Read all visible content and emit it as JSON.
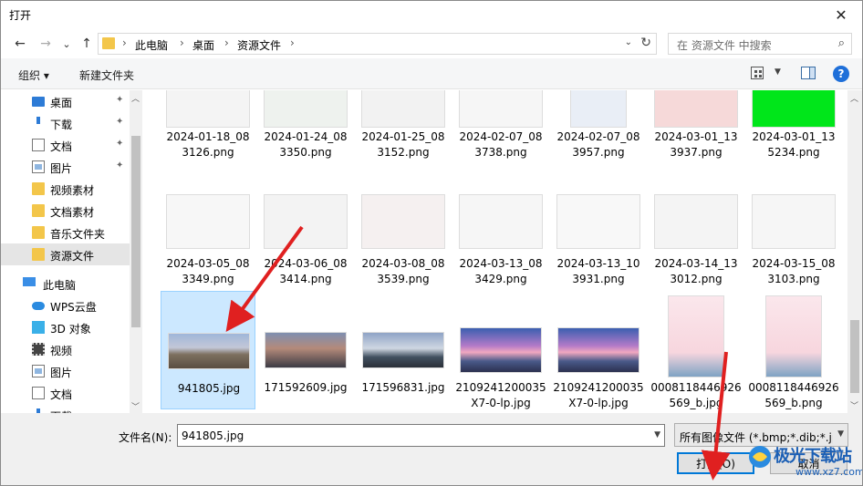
{
  "window": {
    "title": "打开",
    "close_label": "✕"
  },
  "nav": {
    "back": "←",
    "forward": "→",
    "dropdown": "⌄",
    "up": "↑"
  },
  "breadcrumb": [
    "此电脑",
    "桌面",
    "资源文件"
  ],
  "address": {
    "separator": "›",
    "dropdown": "⌄",
    "refresh": "↻"
  },
  "search": {
    "placeholder": "在 资源文件 中搜索",
    "icon": "⌕"
  },
  "toolbar": {
    "organize": "组织 ▾",
    "new_folder": "新建文件夹",
    "view_dropdown": "▼",
    "help": "?"
  },
  "sidebar": {
    "items": [
      {
        "label": "桌面",
        "pinned": true,
        "icon": "desktop-icon"
      },
      {
        "label": "下载",
        "pinned": true,
        "icon": "download-icon"
      },
      {
        "label": "文档",
        "pinned": true,
        "icon": "document-icon"
      },
      {
        "label": "图片",
        "pinned": true,
        "icon": "picture-icon"
      },
      {
        "label": "视频素材",
        "pinned": false,
        "icon": "folder-icon"
      },
      {
        "label": "文档素材",
        "pinned": false,
        "icon": "folder-icon"
      },
      {
        "label": "音乐文件夹",
        "pinned": false,
        "icon": "folder-icon"
      },
      {
        "label": "资源文件",
        "pinned": false,
        "icon": "folder-icon",
        "selected": true
      },
      {
        "label": "此电脑",
        "pinned": false,
        "icon": "pc-icon"
      },
      {
        "label": "WPS云盘",
        "pinned": false,
        "icon": "cloud-icon"
      },
      {
        "label": "3D 对象",
        "pinned": false,
        "icon": "cube-icon"
      },
      {
        "label": "视频",
        "pinned": false,
        "icon": "video-icon"
      },
      {
        "label": "图片",
        "pinned": false,
        "icon": "picture-icon"
      },
      {
        "label": "文档",
        "pinned": false,
        "icon": "document-icon"
      },
      {
        "label": "下载",
        "pinned": false,
        "icon": "download-icon"
      }
    ],
    "pin_glyph": "✦"
  },
  "files": {
    "row1": [
      {
        "l1": "2024-01-18_08",
        "l2": "3126.png"
      },
      {
        "l1": "2024-01-24_08",
        "l2": "3350.png"
      },
      {
        "l1": "2024-01-25_08",
        "l2": "3152.png"
      },
      {
        "l1": "2024-02-07_08",
        "l2": "3738.png"
      },
      {
        "l1": "2024-02-07_08",
        "l2": "3957.png"
      },
      {
        "l1": "2024-03-01_13",
        "l2": "3937.png"
      },
      {
        "l1": "2024-03-01_13",
        "l2": "5234.png"
      }
    ],
    "row2": [
      {
        "l1": "2024-03-05_08",
        "l2": "3349.png"
      },
      {
        "l1": "2024-03-06_08",
        "l2": "3414.png"
      },
      {
        "l1": "2024-03-08_08",
        "l2": "3539.png"
      },
      {
        "l1": "2024-03-13_08",
        "l2": "3429.png"
      },
      {
        "l1": "2024-03-13_10",
        "l2": "3931.png"
      },
      {
        "l1": "2024-03-14_13",
        "l2": "3012.png"
      },
      {
        "l1": "2024-03-15_08",
        "l2": "3103.png"
      }
    ],
    "row3": [
      {
        "l1": "941805.jpg",
        "l2": "",
        "selected": true
      },
      {
        "l1": "171592609.jpg",
        "l2": ""
      },
      {
        "l1": "171596831.jpg",
        "l2": ""
      },
      {
        "l1": "2109241200035",
        "l2": "X7-0-lp.jpg"
      },
      {
        "l1": "2109241200035",
        "l2": "X7-0-lp.jpg"
      },
      {
        "l1": "0008118446926",
        "l2": "569_b.jpg"
      },
      {
        "l1": "0008118446926",
        "l2": "569_b.png"
      }
    ]
  },
  "bottom": {
    "filename_label": "文件名(N):",
    "filename_value": "941805.jpg",
    "filetype_value": "所有图像文件 (*.bmp;*.dib;*.jp",
    "open_button": "打开(O)",
    "cancel_button": "取消"
  },
  "watermark": {
    "text": "极光下载站",
    "url": "www.xz7.com"
  },
  "colors": {
    "accent": "#0078d7",
    "selection": "#cce8ff",
    "arrow": "#e02020",
    "watermark": "#1b5fb5"
  }
}
